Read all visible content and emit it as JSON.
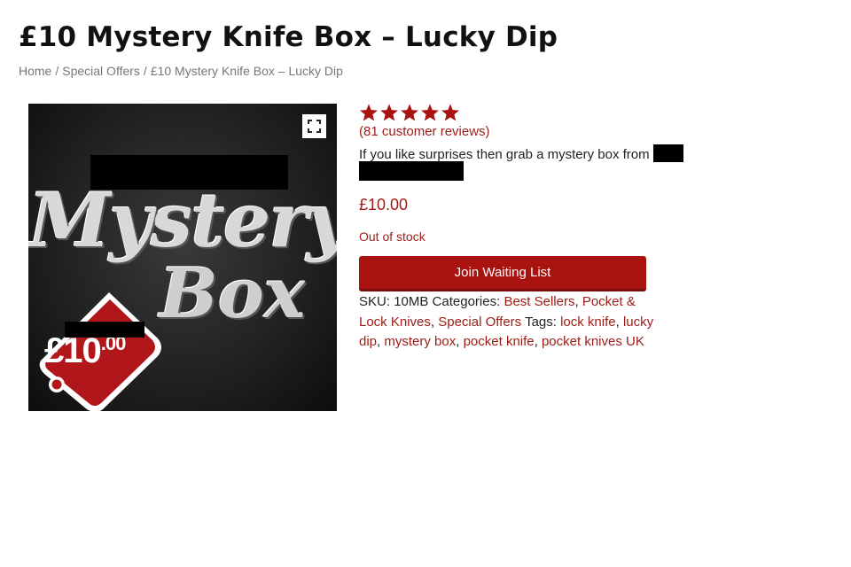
{
  "product": {
    "title": "£10 Mystery Knife Box – Lucky Dip",
    "price": "£10.00",
    "stock_status": "Out of stock",
    "rating": 5,
    "reviews_link": "(81 customer reviews)",
    "description": "If you like surprises then grab a mystery box from",
    "waitlist_button": "Join Waiting List"
  },
  "breadcrumb": {
    "items": [
      "Home",
      "Special Offers",
      "£10 Mystery Knife Box – Lucky Dip"
    ],
    "separator": "/"
  },
  "image": {
    "word_1": "Mystery",
    "word_2": "Box",
    "tag_price_main": "£10",
    "tag_price_cents": ".00",
    "zoom_icon": "expand-icon"
  },
  "meta": {
    "sku_label": "SKU:",
    "sku_value": "10MB",
    "categories_label": "Categories:",
    "categories": [
      "Best Sellers",
      "Pocket & Lock Knives",
      "Special Offers"
    ],
    "tags_label": "Tags:",
    "tags": [
      "lock knife",
      "lucky dip",
      "mystery box",
      "pocket knife",
      "pocket knives UK"
    ]
  },
  "colors": {
    "accent": "#9e1b16",
    "button": "#a8130f",
    "tag_red": "#b0161a"
  }
}
